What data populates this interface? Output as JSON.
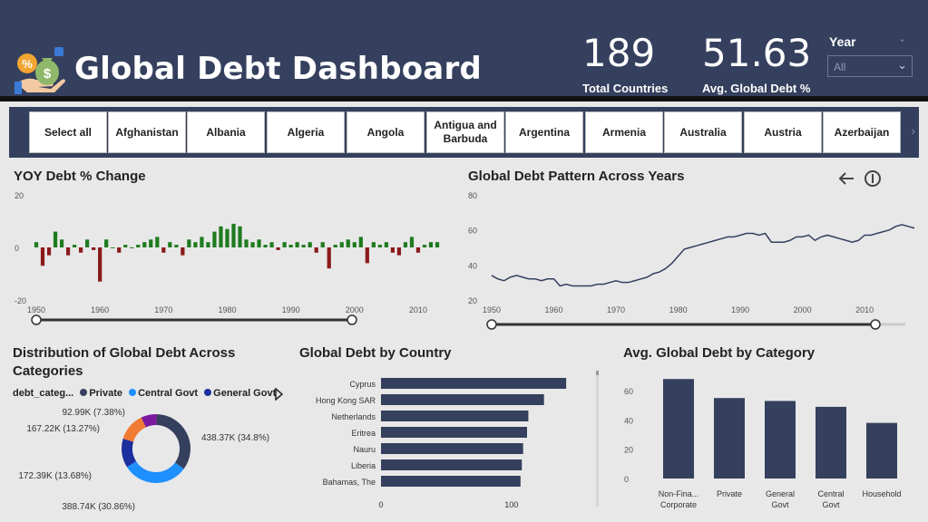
{
  "header": {
    "title": "Global Debt Dashboard",
    "kpis": [
      {
        "value": "189",
        "label": "Total Countries"
      },
      {
        "value": "51.63",
        "label": "Avg. Global Debt %"
      }
    ],
    "year_filter": {
      "label": "Year",
      "selected": "All"
    }
  },
  "filters": [
    "Select all",
    "Afghanistan",
    "Albania",
    "Algeria",
    "Angola",
    "Antigua and Barbuda",
    "Argentina",
    "Armenia",
    "Australia",
    "Austria",
    "Azerbaijan"
  ],
  "colors": {
    "header": "#35405e",
    "positive": "#1e7b1e",
    "negative": "#8b1a1a",
    "bar": "#35405e",
    "private": "#35405e",
    "central_govt": "#1e8fff",
    "general_govt": "#1c2f9e",
    "slice4": "#f07c34",
    "slice5": "#7a1aa0"
  },
  "chart_data": [
    {
      "type": "bar",
      "title": "YOY Debt % Change",
      "xlabel": "",
      "ylabel": "",
      "xlim": [
        1950,
        2013
      ],
      "ylim": [
        -20,
        20
      ],
      "x_ticks": [
        "1950",
        "1960",
        "1970",
        "1980",
        "1990",
        "2000",
        "2010"
      ],
      "y_ticks": [
        "20",
        "0",
        "-20"
      ],
      "x": [
        1950,
        1951,
        1952,
        1953,
        1954,
        1955,
        1956,
        1957,
        1958,
        1959,
        1960,
        1961,
        1962,
        1963,
        1964,
        1965,
        1966,
        1967,
        1968,
        1969,
        1970,
        1971,
        1972,
        1973,
        1974,
        1975,
        1976,
        1977,
        1978,
        1979,
        1980,
        1981,
        1982,
        1983,
        1984,
        1985,
        1986,
        1987,
        1988,
        1989,
        1990,
        1991,
        1992,
        1993,
        1994,
        1995,
        1996,
        1997,
        1998,
        1999,
        2000,
        2001,
        2002,
        2003,
        2004,
        2005,
        2006,
        2007,
        2008,
        2009,
        2010,
        2011,
        2012,
        2013
      ],
      "values": [
        2,
        -7,
        -3,
        6,
        3,
        -3,
        1,
        -2,
        3,
        -1,
        -13,
        3,
        0,
        -2,
        1,
        0,
        1,
        2,
        3,
        4,
        -2,
        2,
        1,
        -3,
        3,
        2,
        4,
        2,
        6,
        8,
        7,
        9,
        8,
        3,
        2,
        3,
        1,
        2,
        -1,
        2,
        1,
        2,
        1,
        2,
        -2,
        2,
        -8,
        1,
        2,
        3,
        2,
        4,
        -6,
        2,
        1,
        2,
        -2,
        -3,
        2,
        4,
        -2,
        1,
        2,
        2
      ]
    },
    {
      "type": "line",
      "title": "Global Debt Pattern Across Years",
      "xlim": [
        1950,
        2018
      ],
      "ylim": [
        20,
        80
      ],
      "x_ticks": [
        "1950",
        "1960",
        "1970",
        "1980",
        "1990",
        "2000",
        "2010"
      ],
      "y_ticks": [
        "80",
        "60",
        "40",
        "20"
      ],
      "x": [
        1950,
        1951,
        1952,
        1953,
        1954,
        1955,
        1956,
        1957,
        1958,
        1959,
        1960,
        1961,
        1962,
        1963,
        1964,
        1965,
        1966,
        1967,
        1968,
        1969,
        1970,
        1971,
        1972,
        1973,
        1974,
        1975,
        1976,
        1977,
        1978,
        1979,
        1980,
        1981,
        1982,
        1983,
        1984,
        1985,
        1986,
        1987,
        1988,
        1989,
        1990,
        1991,
        1992,
        1993,
        1994,
        1995,
        1996,
        1997,
        1998,
        1999,
        2000,
        2001,
        2002,
        2003,
        2004,
        2005,
        2006,
        2007,
        2008,
        2009,
        2010,
        2011,
        2012,
        2013,
        2014,
        2015,
        2016,
        2017,
        2018
      ],
      "values": [
        34,
        32,
        31,
        33,
        34,
        33,
        32,
        32,
        31,
        32,
        32,
        28,
        29,
        28,
        28,
        28,
        28,
        29,
        29,
        30,
        31,
        30,
        30,
        31,
        32,
        33,
        35,
        36,
        38,
        41,
        45,
        49,
        50,
        51,
        52,
        53,
        54,
        55,
        56,
        56,
        57,
        58,
        58,
        57,
        58,
        53,
        53,
        53,
        54,
        56,
        56,
        57,
        54,
        56,
        57,
        56,
        55,
        54,
        53,
        54,
        57,
        57,
        58,
        59,
        60,
        62,
        63,
        62,
        61
      ]
    },
    {
      "type": "pie",
      "title": "Distribution of Global Debt Across Categories",
      "legend_title": "debt_categ...",
      "legend": [
        "Private",
        "Central Govt",
        "General Govt"
      ],
      "slices": [
        {
          "value": 438370,
          "label": "438.37K (34.8%)",
          "color": "#35405e"
        },
        {
          "value": 388740,
          "label": "388.74K (30.86%)",
          "color": "#1e8fff"
        },
        {
          "value": 172390,
          "label": "172.39K (13.68%)",
          "color": "#1c2f9e"
        },
        {
          "value": 167220,
          "label": "167.22K (13.27%)",
          "color": "#f07c34"
        },
        {
          "value": 92990,
          "label": "92.99K (7.38%)",
          "color": "#7a1aa0"
        }
      ]
    },
    {
      "type": "bar",
      "orientation": "horizontal",
      "title": "Global Debt by Country",
      "categories": [
        "Cyprus",
        "Hong Kong SAR",
        "Netherlands",
        "Eritrea",
        "Nauru",
        "Liberia",
        "Bahamas, The"
      ],
      "values": [
        142,
        125,
        113,
        112,
        109,
        108,
        107
      ],
      "xlim": [
        0,
        160
      ],
      "x_ticks": [
        "0",
        "100"
      ]
    },
    {
      "type": "bar",
      "title": "Avg. Global Debt by Category",
      "categories": [
        "Non-Fina... Corporate",
        "Private",
        "General Govt",
        "Central Govt",
        "Household"
      ],
      "category_lines": [
        [
          "Non-Fina...",
          "Corporate"
        ],
        [
          "Private"
        ],
        [
          "General",
          "Govt"
        ],
        [
          "Central",
          "Govt"
        ],
        [
          "Household"
        ]
      ],
      "values": [
        68,
        55,
        53,
        49,
        38
      ],
      "ylim": [
        0,
        70
      ],
      "y_ticks": [
        "60",
        "40",
        "20",
        "0"
      ]
    }
  ]
}
